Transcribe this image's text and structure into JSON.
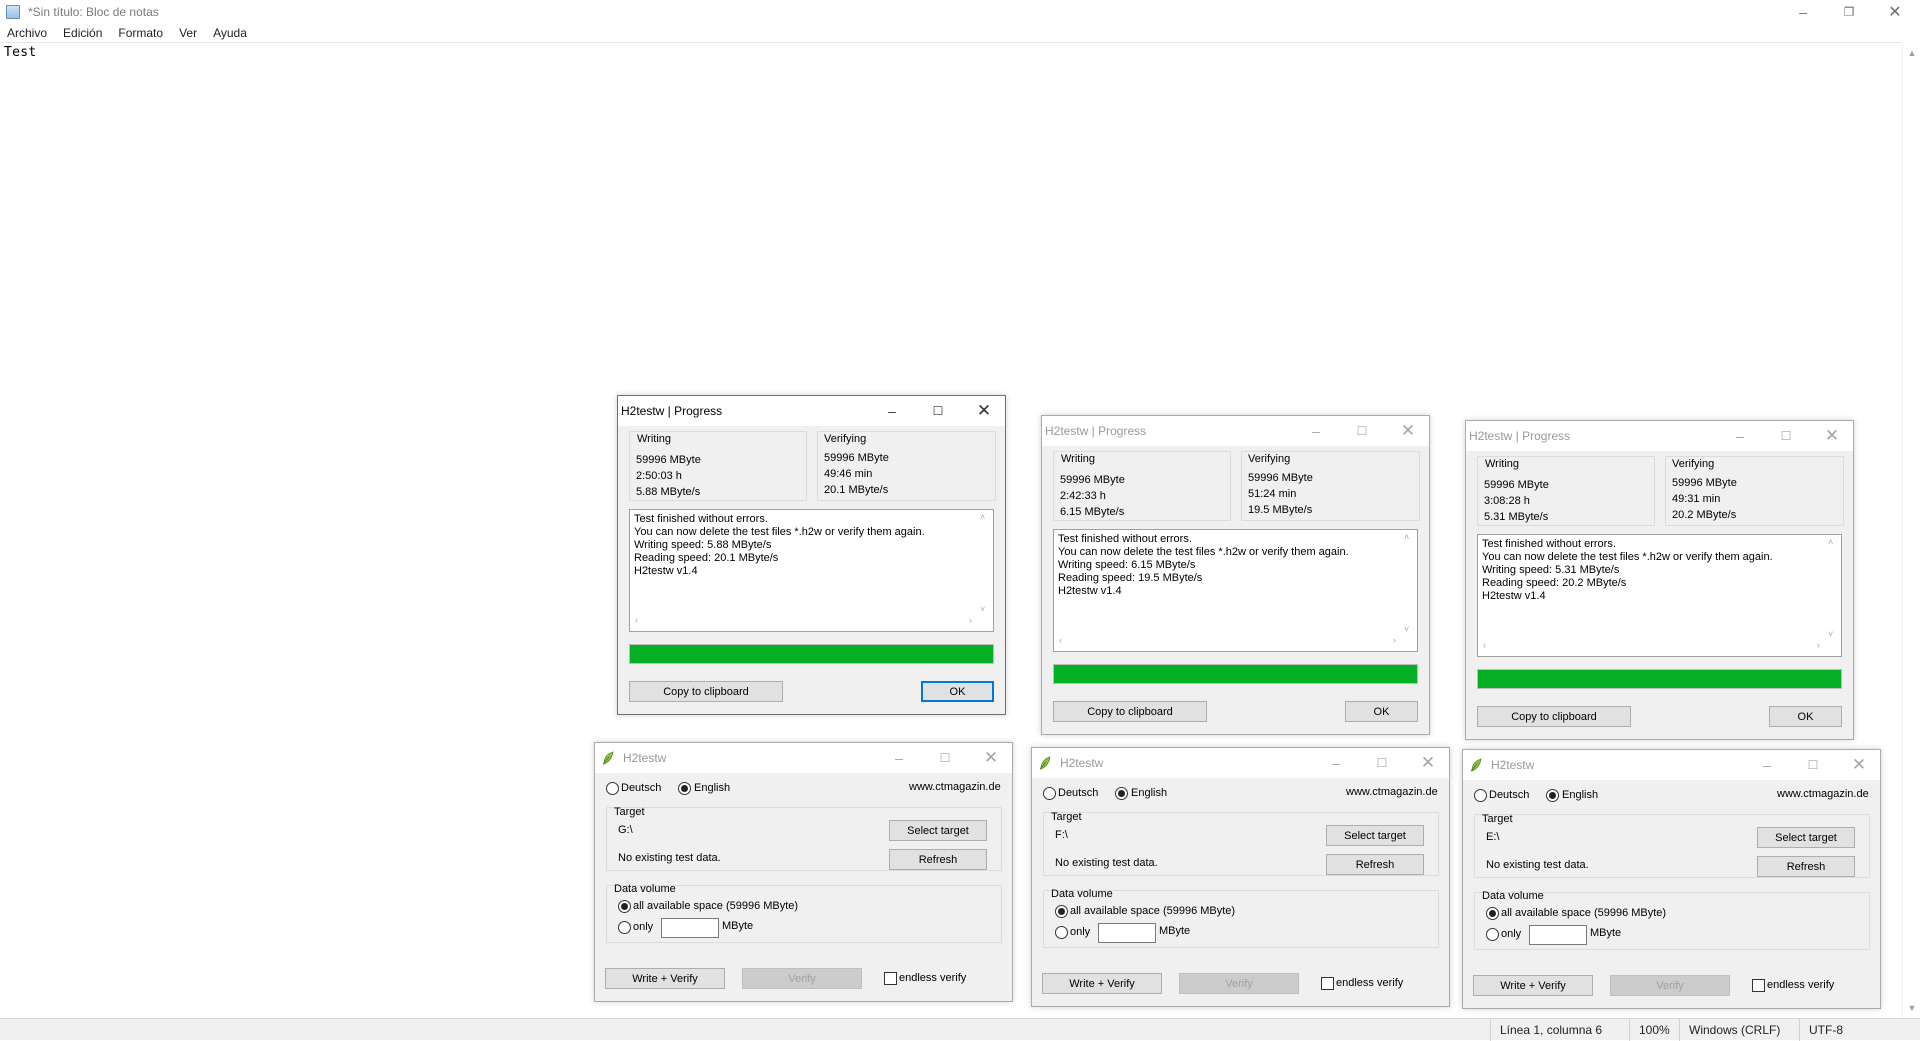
{
  "notepad": {
    "title": "*Sin título: Bloc de notas",
    "menu": [
      "Archivo",
      "Edición",
      "Formato",
      "Ver",
      "Ayuda"
    ],
    "content": "Test",
    "status": {
      "position": "Línea 1, columna 6",
      "zoom": "100%",
      "line_ending": "Windows (CRLF)",
      "encoding": "UTF-8"
    }
  },
  "progress_windows": [
    {
      "title": "H2testw | Progress",
      "writing_label": "Writing",
      "writing": [
        "59996 MByte",
        "2:50:03 h",
        "5.88 MByte/s"
      ],
      "verifying_label": "Verifying",
      "verifying": [
        "59996 MByte",
        "49:46 min",
        "20.1 MByte/s"
      ],
      "log": "Test finished without errors.\nYou can now delete the test files *.h2w or verify them again.\nWriting speed: 5.88 MByte/s\nReading speed: 20.1 MByte/s\nH2testw v1.4",
      "progress": 1.0,
      "copy_label": "Copy to clipboard",
      "ok_label": "OK"
    },
    {
      "title": "H2testw | Progress",
      "writing_label": "Writing",
      "writing": [
        "59996 MByte",
        "2:42:33 h",
        "6.15 MByte/s"
      ],
      "verifying_label": "Verifying",
      "verifying": [
        "59996 MByte",
        "51:24 min",
        "19.5 MByte/s"
      ],
      "log": "Test finished without errors.\nYou can now delete the test files *.h2w or verify them again.\nWriting speed: 6.15 MByte/s\nReading speed: 19.5 MByte/s\nH2testw v1.4",
      "progress": 1.0,
      "copy_label": "Copy to clipboard",
      "ok_label": "OK"
    },
    {
      "title": "H2testw | Progress",
      "writing_label": "Writing",
      "writing": [
        "59996 MByte",
        "3:08:28 h",
        "5.31 MByte/s"
      ],
      "verifying_label": "Verifying",
      "verifying": [
        "59996 MByte",
        "49:31 min",
        "20.2 MByte/s"
      ],
      "log": "Test finished without errors.\nYou can now delete the test files *.h2w or verify them again.\nWriting speed: 5.31 MByte/s\nReading speed: 20.2 MByte/s\nH2testw v1.4",
      "progress": 1.0,
      "copy_label": "Copy to clipboard",
      "ok_label": "OK"
    }
  ],
  "main_windows": [
    {
      "title": "H2testw",
      "lang_de": "Deutsch",
      "lang_en": "English",
      "url": "www.ctmagazin.de",
      "target_label": "Target",
      "target": "G:\\",
      "select_target": "Select target",
      "status": "No existing test data.",
      "refresh": "Refresh",
      "volume_label": "Data volume",
      "all_space": "all available space (59996 MByte)",
      "only": "only",
      "unit": "MByte",
      "write_verify": "Write + Verify",
      "verify": "Verify",
      "endless": "endless verify"
    },
    {
      "title": "H2testw",
      "lang_de": "Deutsch",
      "lang_en": "English",
      "url": "www.ctmagazin.de",
      "target_label": "Target",
      "target": "F:\\",
      "select_target": "Select target",
      "status": "No existing test data.",
      "refresh": "Refresh",
      "volume_label": "Data volume",
      "all_space": "all available space (59996 MByte)",
      "only": "only",
      "unit": "MByte",
      "write_verify": "Write + Verify",
      "verify": "Verify",
      "endless": "endless verify"
    },
    {
      "title": "H2testw",
      "lang_de": "Deutsch",
      "lang_en": "English",
      "url": "www.ctmagazin.de",
      "target_label": "Target",
      "target": "E:\\",
      "select_target": "Select target",
      "status": "No existing test data.",
      "refresh": "Refresh",
      "volume_label": "Data volume",
      "all_space": "all available space (59996 MByte)",
      "only": "only",
      "unit": "MByte",
      "write_verify": "Write + Verify",
      "verify": "Verify",
      "endless": "endless verify"
    }
  ],
  "colors": {
    "progress_fill": "#06b025",
    "default_button_border": "#0078d7"
  },
  "icons": {
    "notepad": "notepad-icon",
    "h2testw": "h2testw-leaf-icon",
    "minimize": "minimize-icon",
    "maximize": "maximize-icon",
    "close": "close-icon"
  }
}
